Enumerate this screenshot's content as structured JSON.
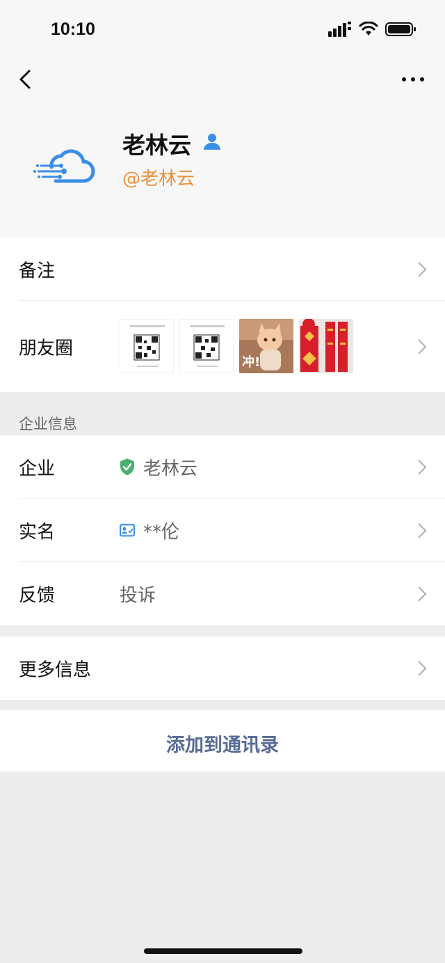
{
  "status": {
    "time": "10:10"
  },
  "profile": {
    "name": "老林云",
    "handle": "@老林云"
  },
  "rows": {
    "remark_label": "备注",
    "moments_label": "朋友圈",
    "moments_thumb_overlay": "冲!"
  },
  "enterprise": {
    "section_title": "企业信息",
    "company_label": "企业",
    "company_value": "老林云",
    "realname_label": "实名",
    "realname_value": "**伦",
    "feedback_label": "反馈",
    "feedback_value": "投诉"
  },
  "more": {
    "label": "更多信息"
  },
  "actions": {
    "add_contact": "添加到通讯录"
  },
  "colors": {
    "accent_link": "#576b95",
    "handle_orange": "#e8913e",
    "verified_green": "#4caf6e",
    "brand_blue": "#3a8ee6"
  }
}
